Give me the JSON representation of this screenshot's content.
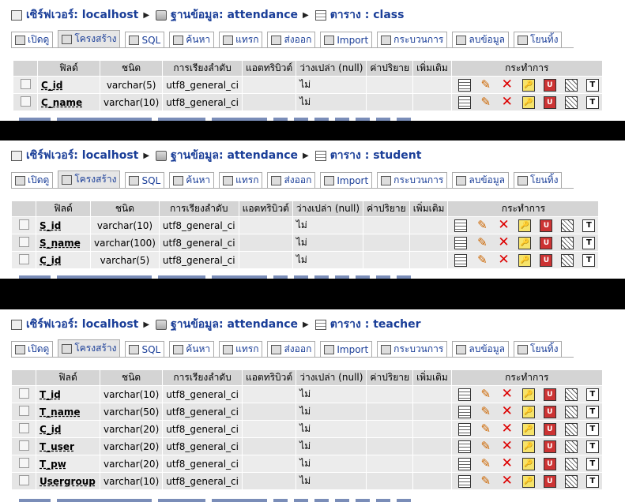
{
  "common": {
    "server_label": "เซิร์ฟเวอร์: localhost",
    "db_label": "ฐานข้อมูล: attendance",
    "tabs": [
      {
        "label": "เปิดดู",
        "icon": "browse-icon"
      },
      {
        "label": "โครงสร้าง",
        "icon": "structure-icon"
      },
      {
        "label": "SQL",
        "icon": "sql-icon"
      },
      {
        "label": "ค้นหา",
        "icon": "search-icon"
      },
      {
        "label": "แทรก",
        "icon": "insert-icon"
      },
      {
        "label": "ส่งออก",
        "icon": "export-icon"
      },
      {
        "label": "Import",
        "icon": "import-icon"
      },
      {
        "label": "กระบวนการ",
        "icon": "operations-icon"
      },
      {
        "label": "ลบข้อมูล",
        "icon": "empty-icon"
      },
      {
        "label": "โยนทิ้ง",
        "icon": "drop-icon"
      }
    ],
    "headers": [
      "ฟิลด์",
      "ชนิด",
      "การเรียงลำดับ",
      "แอตทริบิวต์",
      "ว่างเปล่า (null)",
      "ค่าปริยาย",
      "เพิ่มเติม",
      "กระทำการ"
    ]
  },
  "panels": [
    {
      "table_label": "ตาราง : class",
      "rows": [
        {
          "field": "C_id",
          "type": "varchar(5)",
          "collation": "utf8_general_ci",
          "null": "ไม่"
        },
        {
          "field": "C_name",
          "type": "varchar(10)",
          "collation": "utf8_general_ci",
          "null": "ไม่"
        }
      ]
    },
    {
      "table_label": "ตาราง : student",
      "rows": [
        {
          "field": "S_id",
          "type": "varchar(10)",
          "collation": "utf8_general_ci",
          "null": "ไม่"
        },
        {
          "field": "S_name",
          "type": "varchar(100)",
          "collation": "utf8_general_ci",
          "null": "ไม่"
        },
        {
          "field": "C_id",
          "type": "varchar(5)",
          "collation": "utf8_general_ci",
          "null": "ไม่"
        }
      ]
    },
    {
      "table_label": "ตาราง : teacher",
      "rows": [
        {
          "field": "T_id",
          "type": "varchar(10)",
          "collation": "utf8_general_ci",
          "null": "ไม่"
        },
        {
          "field": "T_name",
          "type": "varchar(50)",
          "collation": "utf8_general_ci",
          "null": "ไม่"
        },
        {
          "field": "C_id",
          "type": "varchar(20)",
          "collation": "utf8_general_ci",
          "null": "ไม่"
        },
        {
          "field": "T_user",
          "type": "varchar(20)",
          "collation": "utf8_general_ci",
          "null": "ไม่"
        },
        {
          "field": "T_pw",
          "type": "varchar(20)",
          "collation": "utf8_general_ci",
          "null": "ไม่"
        },
        {
          "field": "Usergroup",
          "type": "varchar(10)",
          "collation": "utf8_general_ci",
          "null": "ไม่"
        }
      ]
    }
  ],
  "action_icons": [
    "browse-icon",
    "edit-icon",
    "drop-icon",
    "primary-key-icon",
    "unique-icon",
    "index-icon",
    "fulltext-icon"
  ]
}
